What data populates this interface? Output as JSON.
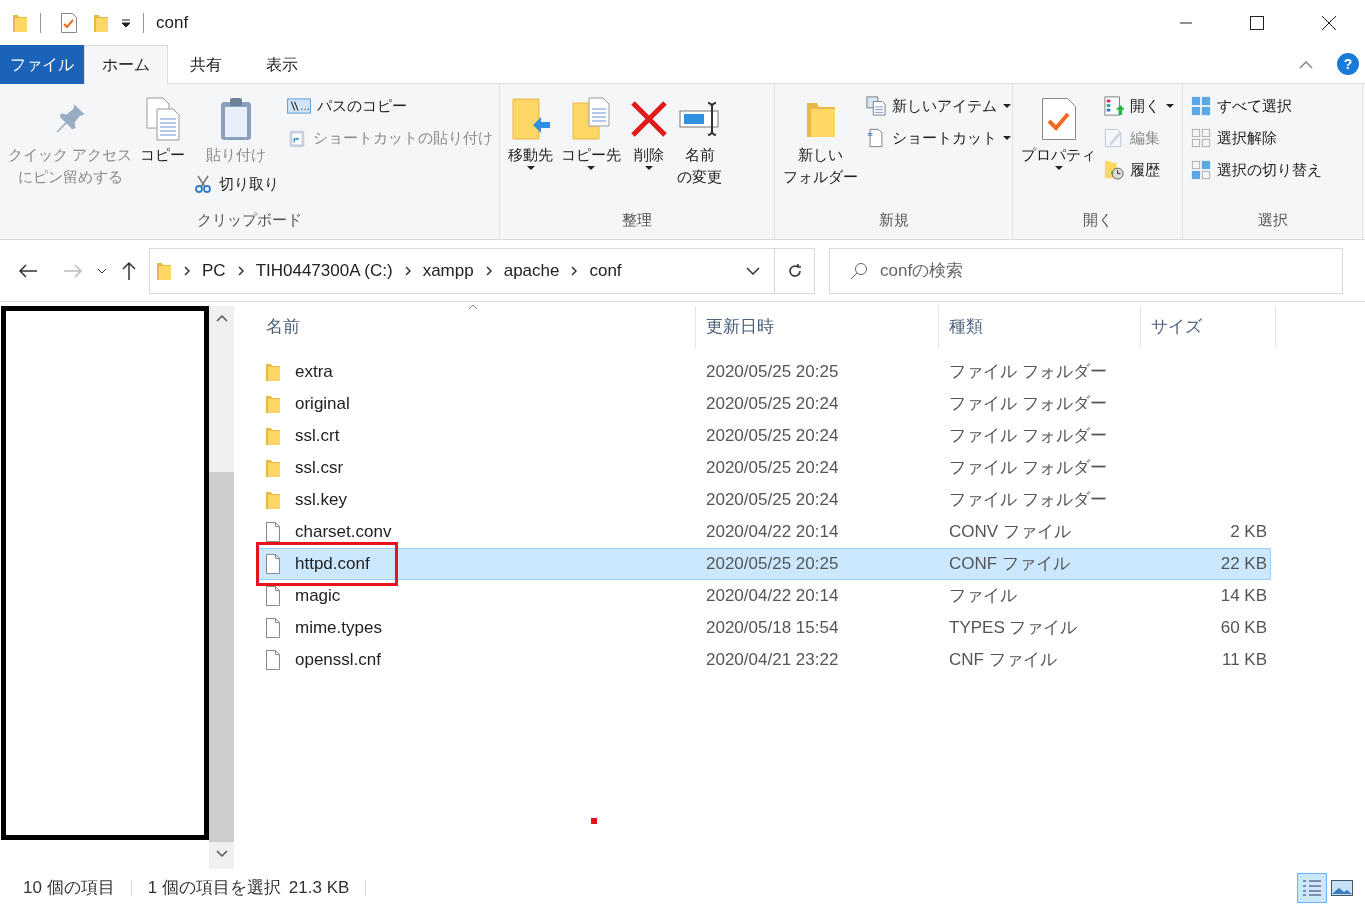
{
  "title_bar": {
    "title": "conf"
  },
  "ribbon_tabs": [
    {
      "label": "ファイル",
      "kind": "file",
      "selected": false
    },
    {
      "label": "ホーム",
      "kind": "tab",
      "selected": true
    },
    {
      "label": "共有",
      "kind": "tab",
      "selected": false
    },
    {
      "label": "表示",
      "kind": "tab",
      "selected": false
    }
  ],
  "ribbon_groups": [
    {
      "label": "クリップボード",
      "columns": [
        [
          {
            "kind": "large",
            "lines": [
              "クイック アクセス",
              "にピン留めする"
            ],
            "disabled": true,
            "dropdown": false
          }
        ],
        [
          {
            "kind": "large",
            "lines": [
              "コピー"
            ],
            "disabled": false,
            "dropdown": false
          }
        ],
        [
          {
            "kind": "large",
            "lines": [
              "貼り付け"
            ],
            "disabled": true,
            "dropdown": false
          },
          {
            "kind": "small",
            "label": "切り取り",
            "disabled": false,
            "dropdown": false
          }
        ],
        [
          {
            "kind": "small",
            "label": "パスのコピー",
            "disabled": false,
            "dropdown": false
          },
          {
            "kind": "small",
            "label": "ショートカットの貼り付け",
            "disabled": true,
            "dropdown": false
          }
        ]
      ]
    },
    {
      "label": "整理",
      "columns": [
        [
          {
            "kind": "large",
            "lines": [
              "移動先"
            ],
            "disabled": false,
            "dropdown": true
          }
        ],
        [
          {
            "kind": "large",
            "lines": [
              "コピー先"
            ],
            "disabled": false,
            "dropdown": true
          }
        ],
        [
          {
            "kind": "large",
            "lines": [
              "削除"
            ],
            "disabled": false,
            "dropdown": true
          }
        ],
        [
          {
            "kind": "large",
            "lines": [
              "名前",
              "の変更"
            ],
            "disabled": false,
            "dropdown": false
          }
        ]
      ]
    },
    {
      "label": "新規",
      "columns": [
        [
          {
            "kind": "large",
            "lines": [
              "新しい",
              "フォルダー"
            ],
            "disabled": false,
            "dropdown": false
          }
        ],
        [
          {
            "kind": "small",
            "label": "新しいアイテム",
            "disabled": false,
            "dropdown": true
          },
          {
            "kind": "small",
            "label": "ショートカット",
            "disabled": false,
            "dropdown": true
          }
        ]
      ]
    },
    {
      "label": "開く",
      "columns": [
        [
          {
            "kind": "large",
            "lines": [
              "プロパティ"
            ],
            "disabled": false,
            "dropdown": true
          }
        ],
        [
          {
            "kind": "small",
            "label": "開く",
            "disabled": false,
            "dropdown": true
          },
          {
            "kind": "small",
            "label": "編集",
            "disabled": true,
            "dropdown": false
          },
          {
            "kind": "small",
            "label": "履歴",
            "disabled": false,
            "dropdown": false
          }
        ]
      ]
    },
    {
      "label": "選択",
      "columns": [
        [
          {
            "kind": "small",
            "label": "すべて選択",
            "disabled": false,
            "dropdown": false
          },
          {
            "kind": "small",
            "label": "選択解除",
            "disabled": false,
            "dropdown": false
          },
          {
            "kind": "small",
            "label": "選択の切り替え",
            "disabled": false,
            "dropdown": false
          }
        ]
      ]
    }
  ],
  "help": {
    "label": "?"
  },
  "address_bar": {
    "path": [
      "PC",
      "TIH0447300A (C:)",
      "xampp",
      "apache",
      "conf"
    ]
  },
  "search": {
    "placeholder": "confの検索"
  },
  "file_list": {
    "columns": [
      "名前",
      "更新日時",
      "種類",
      "サイズ"
    ],
    "rows": [
      {
        "kind": "folder",
        "name": "extra",
        "date": "2020/05/25 20:25",
        "type": "ファイル フォルダー",
        "selected": false,
        "marked": false
      },
      {
        "kind": "folder",
        "name": "original",
        "date": "2020/05/25 20:24",
        "type": "ファイル フォルダー",
        "selected": false,
        "marked": false
      },
      {
        "kind": "folder",
        "name": "ssl.crt",
        "date": "2020/05/25 20:24",
        "type": "ファイル フォルダー",
        "selected": false,
        "marked": false
      },
      {
        "kind": "folder",
        "name": "ssl.csr",
        "date": "2020/05/25 20:24",
        "type": "ファイル フォルダー",
        "selected": false,
        "marked": false
      },
      {
        "kind": "folder",
        "name": "ssl.key",
        "date": "2020/05/25 20:24",
        "type": "ファイル フォルダー",
        "selected": false,
        "marked": false
      },
      {
        "kind": "file",
        "name": "charset.conv",
        "date": "2020/04/22 20:14",
        "type": "CONV ファイル",
        "size": "2 KB",
        "selected": false,
        "marked": false
      },
      {
        "kind": "file",
        "name": "httpd.conf",
        "date": "2020/05/25 20:25",
        "type": "CONF ファイル",
        "size": "22 KB",
        "selected": true,
        "marked": true
      },
      {
        "kind": "file",
        "name": "magic",
        "date": "2020/04/22 20:14",
        "type": "ファイル",
        "size": "14 KB",
        "selected": false,
        "marked": false
      },
      {
        "kind": "file",
        "name": "mime.types",
        "date": "2020/05/18 15:54",
        "type": "TYPES ファイル",
        "size": "60 KB",
        "selected": false,
        "marked": false
      },
      {
        "kind": "file",
        "name": "openssl.cnf",
        "date": "2020/04/21 23:22",
        "type": "CNF ファイル",
        "size": "11 KB",
        "selected": false,
        "marked": false
      }
    ]
  },
  "status_bar": {
    "item_count": "10 個の項目",
    "selection": "1 個の項目を選択",
    "selection_size": "21.3 KB"
  },
  "view_buttons": [
    {
      "kind": "details",
      "selected": true
    },
    {
      "kind": "large_icons",
      "selected": false
    }
  ]
}
